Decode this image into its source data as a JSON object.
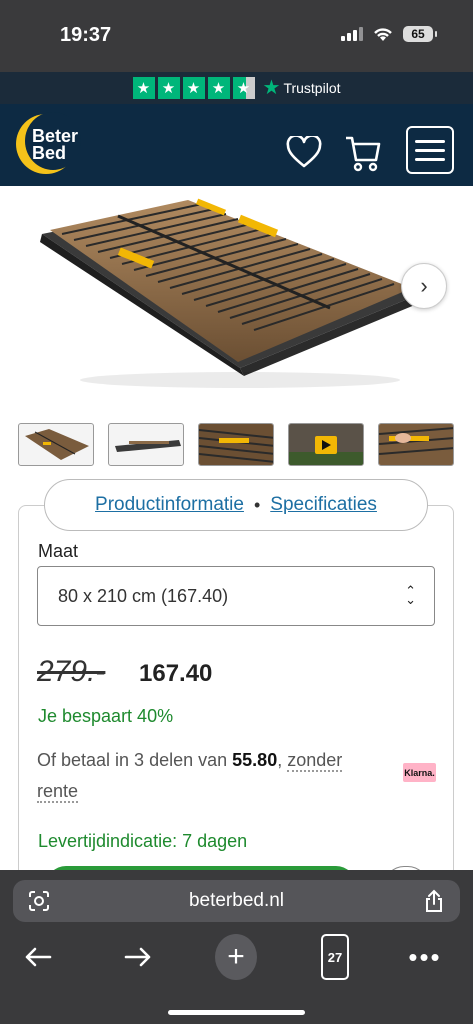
{
  "status_bar": {
    "time": "19:37",
    "battery": "65"
  },
  "trustpilot": {
    "label": "Trustpilot",
    "stars": 4.5
  },
  "header": {
    "logo_line1": "Beter",
    "logo_line2": "Bed"
  },
  "carousel": {
    "thumbnails": [
      "slat-base-top",
      "slat-base-side",
      "slat-detail",
      "video",
      "slat-adjust"
    ]
  },
  "tabs": {
    "product_info": "Productinformatie",
    "separator": "•",
    "specs": "Specificaties"
  },
  "size": {
    "label": "Maat",
    "value": "80 x 210 cm (167.40)"
  },
  "price": {
    "old": "279.-",
    "new": "167.40",
    "savings": "Je bespaart 40%"
  },
  "installments": {
    "prefix": "Of betaal in 3 delen van",
    "amount": "55.80",
    "comma": ",",
    "suffix": "zonder rente",
    "provider": "Klarna."
  },
  "delivery": "Levertijdindicatie: 7 dagen",
  "browser": {
    "url": "beterbed.nl",
    "tab_count": "27"
  },
  "colors": {
    "brand_navy": "#0d2a43",
    "brand_yellow": "#f4c21a",
    "trustpilot_green": "#00b67a",
    "success_green": "#1e8a2e",
    "link_blue": "#1d6fa3"
  }
}
